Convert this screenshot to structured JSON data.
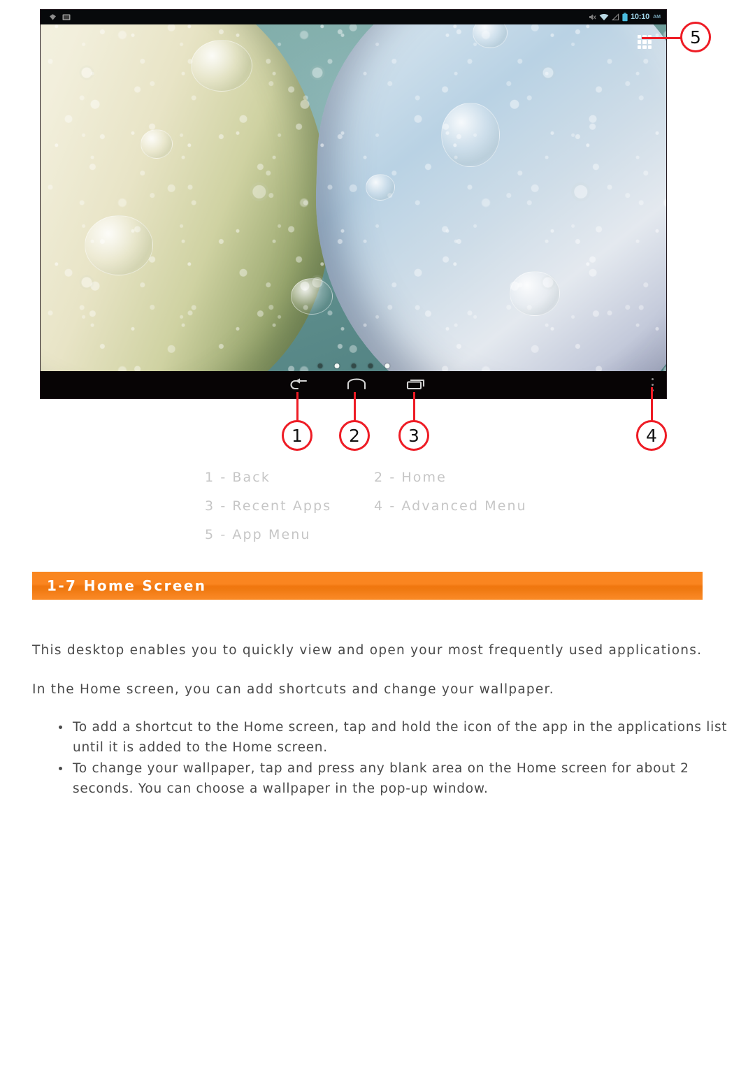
{
  "device": {
    "status_bar": {
      "left_icons": [
        "wifi-notification-icon",
        "screenshot-notification-icon"
      ],
      "right_icons": [
        "mute-icon",
        "wifi-icon",
        "signal-icon",
        "battery-icon"
      ],
      "clock": "10:10",
      "clock_ampm": "AM"
    },
    "app_menu_icon": "app-grid-icon",
    "page_indicator": {
      "count": 5,
      "active_index": 1
    },
    "nav_bar": {
      "back": "back-icon",
      "home": "home-icon",
      "recent": "recent-apps-icon",
      "advanced": "advanced-menu-icon"
    }
  },
  "callouts": [
    {
      "number": "1",
      "target": "back-button"
    },
    {
      "number": "2",
      "target": "home-button"
    },
    {
      "number": "3",
      "target": "recent-apps-button"
    },
    {
      "number": "4",
      "target": "advanced-menu-button"
    },
    {
      "number": "5",
      "target": "app-menu-button"
    }
  ],
  "legend": {
    "rows": [
      [
        "1 - Back",
        "2 - Home"
      ],
      [
        "3 - Recent Apps",
        "4 - Advanced Menu"
      ],
      [
        "5 - App Menu",
        ""
      ]
    ]
  },
  "section": {
    "title": "1-7 Home Screen",
    "accent_color": "#F7801F"
  },
  "body": {
    "paragraphs": [
      "This desktop enables you to quickly view and open your most frequently used applications.",
      "In the Home screen, you can add shortcuts and change your wallpaper."
    ],
    "bullets": [
      "To add a shortcut to the Home screen, tap and hold the icon of the app in the applications list until it is added to the Home screen.",
      "To change your wallpaper, tap and press any blank area on the Home screen for about 2 seconds. You can choose a wallpaper in the pop-up window."
    ]
  }
}
